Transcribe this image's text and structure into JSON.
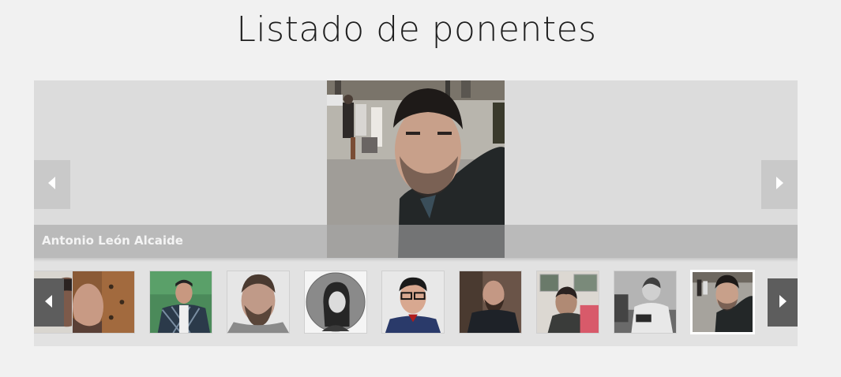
{
  "page": {
    "title": "Listado de ponentes"
  },
  "featured": {
    "name": "Antonio León Alcaide"
  },
  "colors": {
    "background": "#f1f1f1",
    "stage": "#dcdcdc",
    "nav_arrow": "#c9c9c9",
    "strip_arrow": "#5d5d5d",
    "active_border": "#ffffff"
  },
  "icons": {
    "prev": "triangle-left-icon",
    "next": "triangle-right-icon"
  },
  "thumbnails": [
    {
      "name": "speaker-thumb-partial",
      "active": false
    },
    {
      "name": "speaker-thumb-door",
      "active": false
    },
    {
      "name": "speaker-thumb-plaid-shirt",
      "active": false
    },
    {
      "name": "speaker-thumb-bearded",
      "active": false
    },
    {
      "name": "speaker-thumb-woman-circle",
      "active": false
    },
    {
      "name": "speaker-thumb-glasses",
      "active": false
    },
    {
      "name": "speaker-thumb-dark-room",
      "active": false
    },
    {
      "name": "speaker-thumb-pictures-wall",
      "active": false
    },
    {
      "name": "speaker-thumb-bw-couch",
      "active": false
    },
    {
      "name": "speaker-thumb-selfie",
      "active": true
    }
  ]
}
